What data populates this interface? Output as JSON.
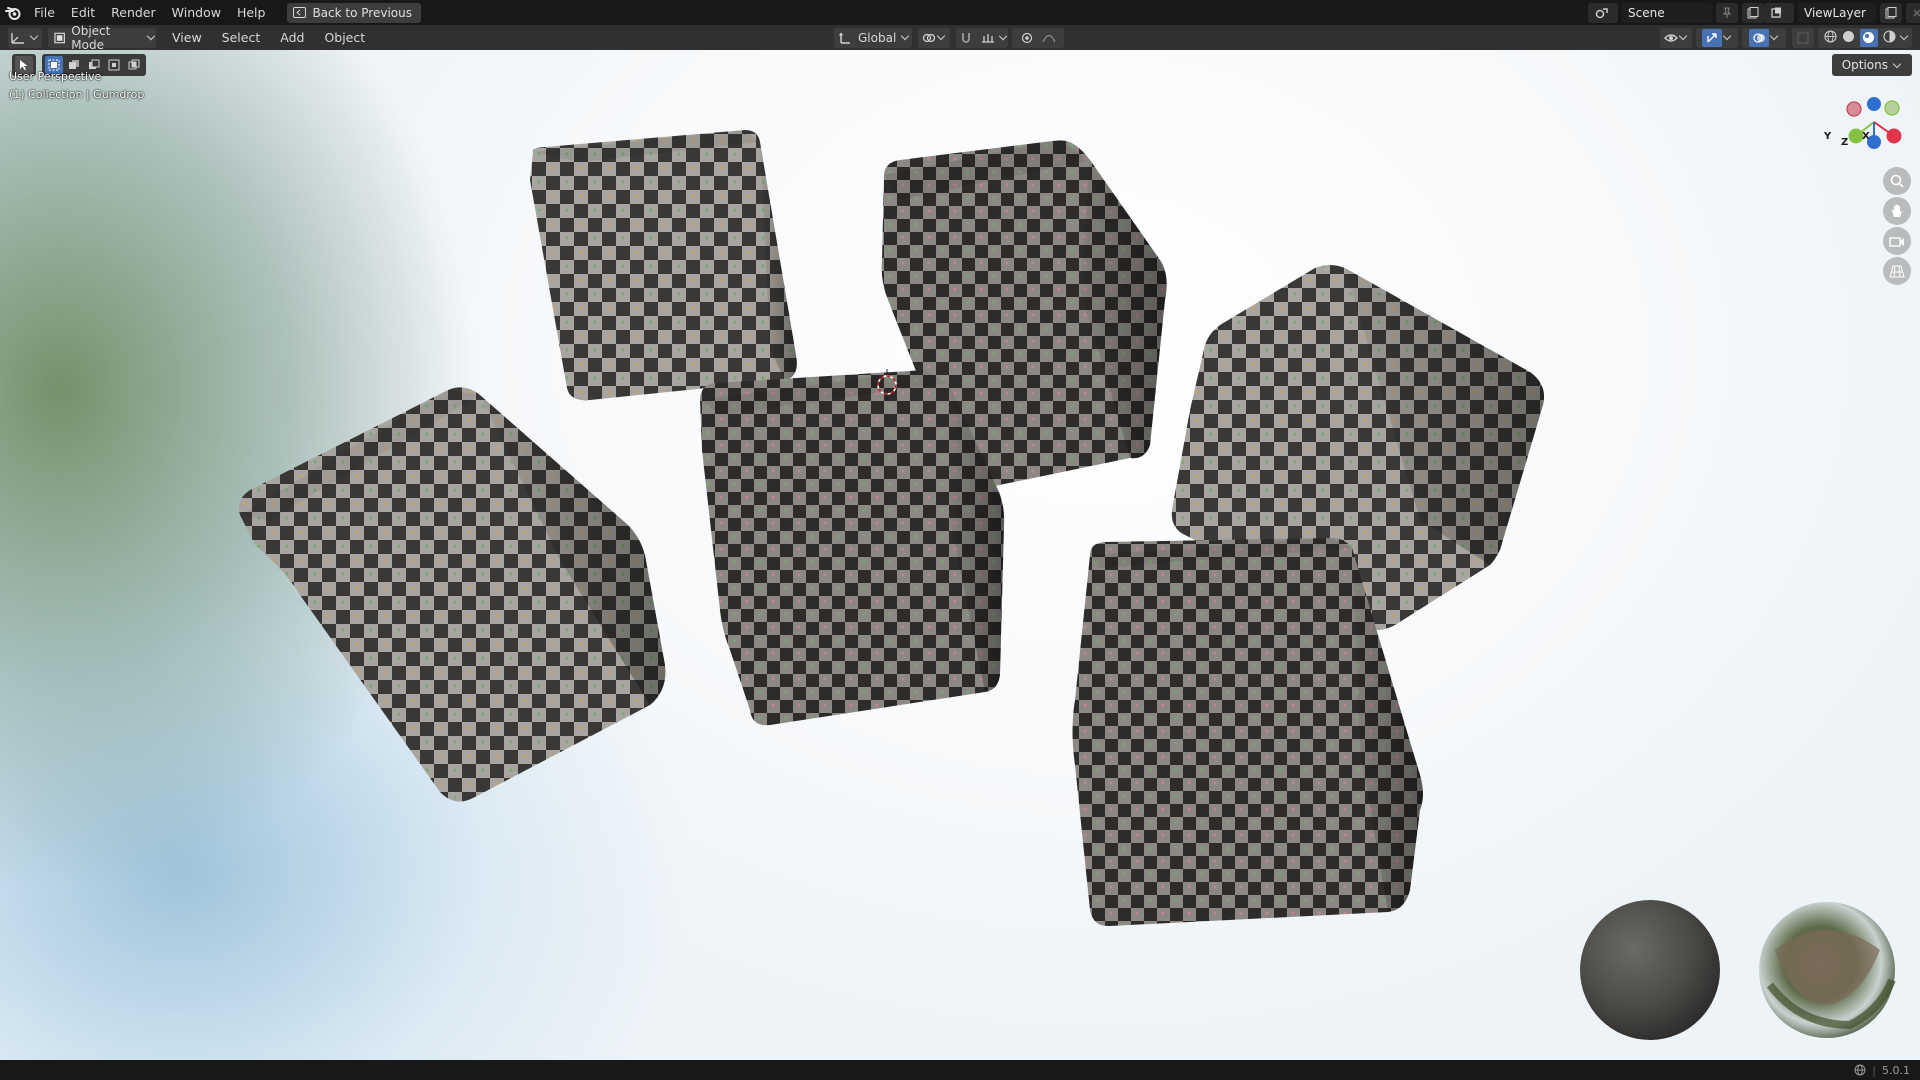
{
  "menubar": {
    "items": [
      "File",
      "Edit",
      "Render",
      "Window",
      "Help"
    ],
    "back_button": "Back to Previous",
    "scene": "Scene",
    "view_layer": "ViewLayer"
  },
  "viewport_header": {
    "mode": "Object Mode",
    "menus": [
      "View",
      "Select",
      "Add",
      "Object"
    ],
    "transform_orientation": "Global",
    "options": "Options"
  },
  "viewport": {
    "perspective": "User Perspective",
    "collection_info": "(1) Collection | Gumdrop",
    "cursor_icon": "3d-cursor-icon",
    "gizmo_axes": [
      "X",
      "Y",
      "Z"
    ],
    "gizmo_colors": {
      "x": "#e2354b",
      "y": "#86c241",
      "z": "#2f6fcf"
    }
  },
  "statusbar": {
    "version": "5.0.1"
  }
}
